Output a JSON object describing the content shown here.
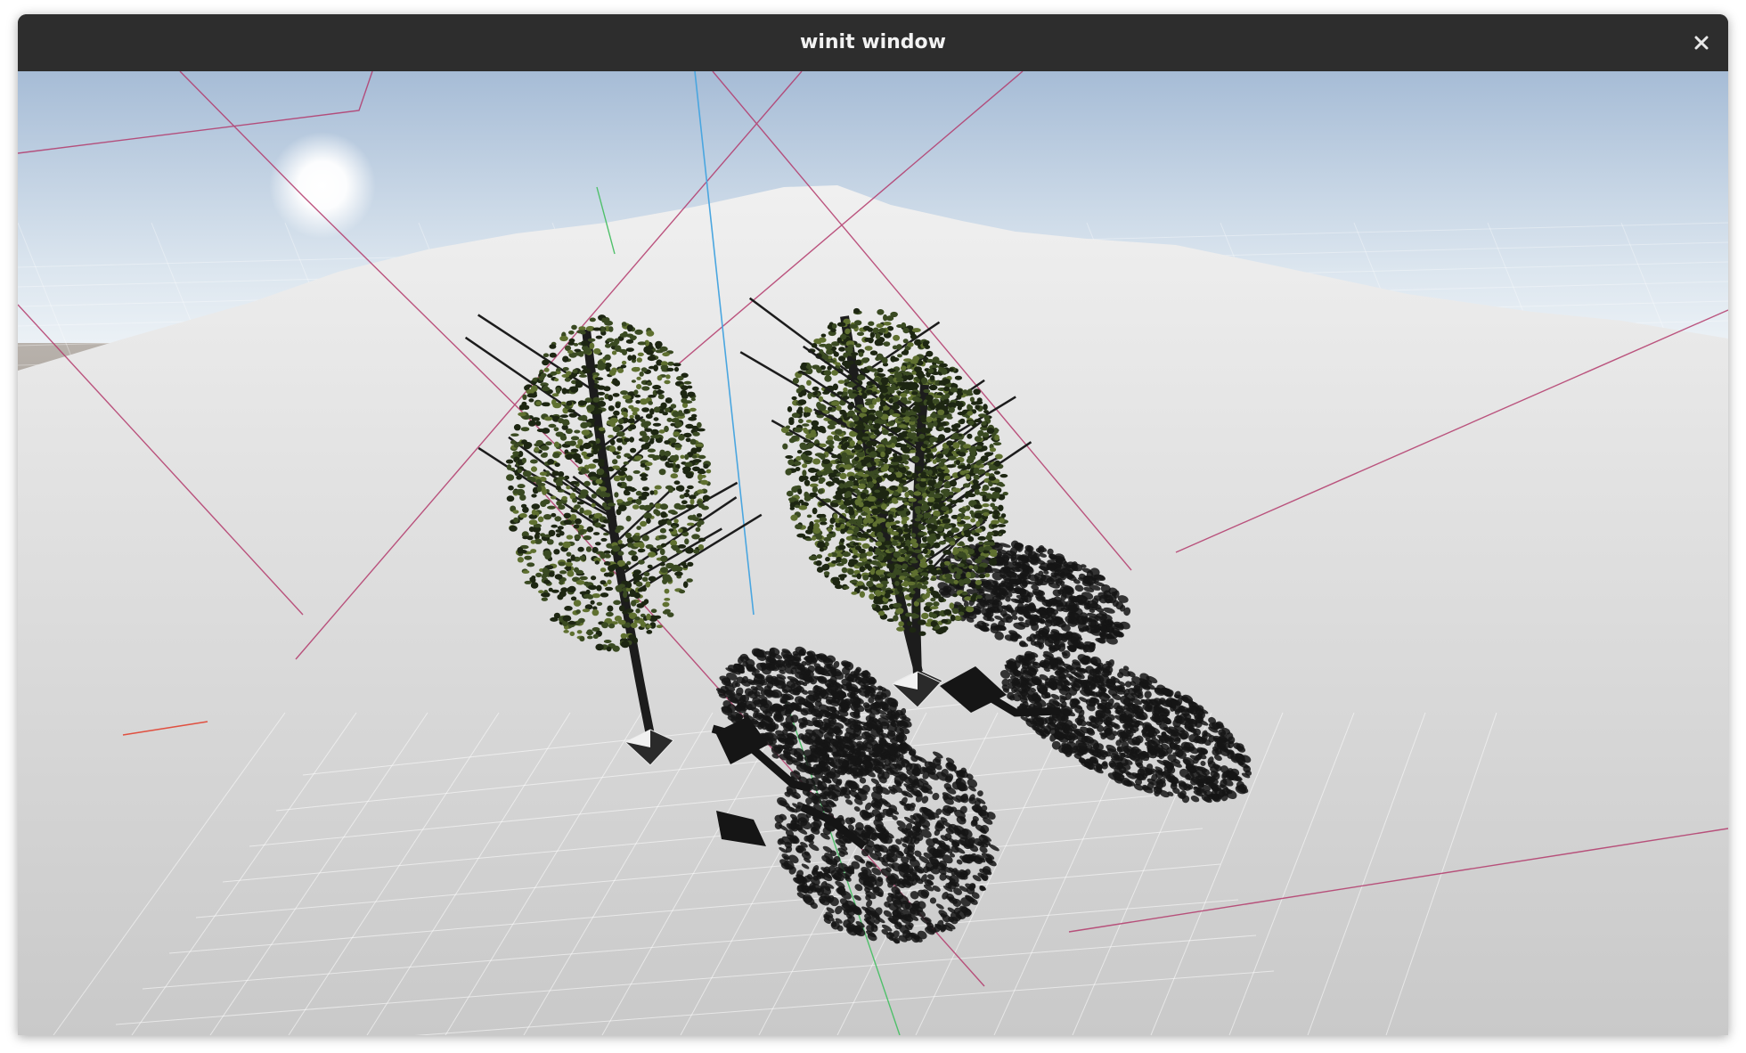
{
  "window": {
    "title": "winit window",
    "close_icon": "close-icon"
  },
  "scene": {
    "kind": "3d-viewport",
    "objects": [
      "sun",
      "sky",
      "terrain",
      "tree",
      "tree",
      "tree-shadow",
      "tree-shadow",
      "tree-shadow",
      "debug-gizmo-lines"
    ],
    "colors": {
      "sky_top": "#a9bfd9",
      "sky_horizon": "#e6eef5",
      "terrain": "#e4e4e4",
      "foliage": "#3a4a22",
      "trunk": "#1c1c1c",
      "shadow": "#151515",
      "debug_line": "#b3396b",
      "axis_y": "#4aa6e0",
      "axis_z": "#4fc06a",
      "axis_x": "#e05040"
    }
  }
}
